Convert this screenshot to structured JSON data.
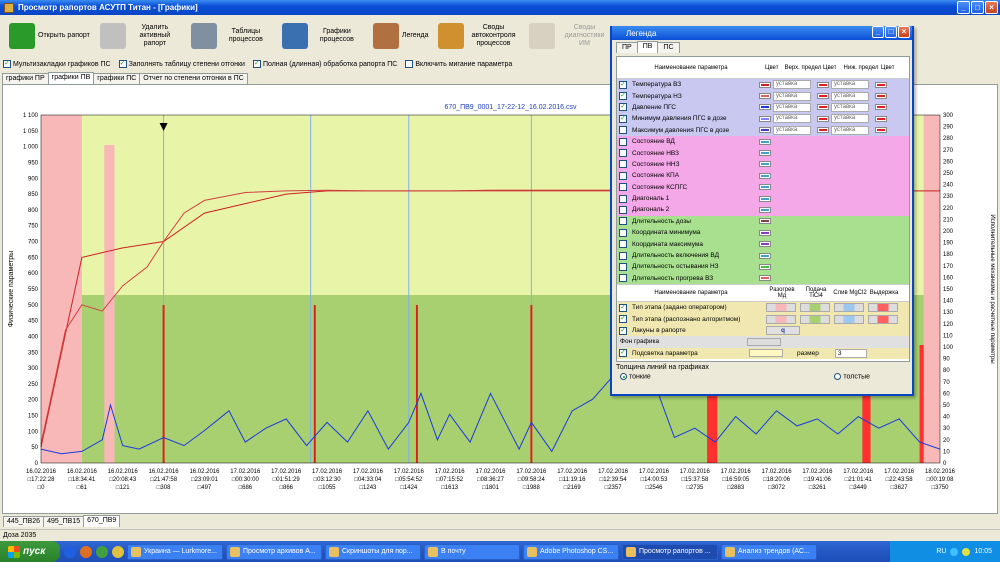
{
  "window": {
    "title": "Просмотр рапортов АСУТП Титан - [Графики]"
  },
  "toolbar": {
    "items": [
      {
        "label": "Открыть рапорт",
        "icon": "open-report-icon",
        "color": "#2a9a2a"
      },
      {
        "label": "Удалить активный рапорт",
        "icon": "delete-report-icon",
        "color": "#c0c0c0"
      },
      {
        "label": "Таблицы процессов",
        "icon": "table-icon",
        "color": "#8090a0"
      },
      {
        "label": "Графики процессов",
        "icon": "chart-icon",
        "color": "#3a70b0"
      },
      {
        "label": "Легенда",
        "icon": "legend-icon",
        "color": "#b07040"
      },
      {
        "label": "Своды автоконтроля процессов",
        "icon": "gears-icon",
        "color": "#d09030"
      },
      {
        "label": "Своды диагностики ИМ",
        "icon": "gears-disabled-icon",
        "color": "#d8d0c0",
        "disabled": true
      }
    ]
  },
  "options": [
    {
      "label": "Мультизакладки графиков ПС",
      "checked": true
    },
    {
      "label": "Заполнять таблицу степени отгонки",
      "checked": true
    },
    {
      "label": "Полная (длинная) обработка рапорта ПС",
      "checked": true
    },
    {
      "label": "Включить мигание параметра",
      "checked": false
    }
  ],
  "view_tabs": [
    {
      "label": "графики ПР",
      "active": false
    },
    {
      "label": "графики ПВ",
      "active": true
    },
    {
      "label": "графики ПС",
      "active": false
    },
    {
      "label": "Отчет по степени отгонки в ПС",
      "active": false
    }
  ],
  "chart": {
    "file_title": "670_ПВ9_0001_17-22-12_16.02.2016.csv",
    "left_axis_label": "Физические параметры",
    "right_axis_label": "Исполнительные механизмы и расчетные параметры",
    "bg_colors": {
      "light": "#e8f5a8",
      "green": "#a8d070",
      "pink": "#f8b8b8",
      "red": "#ff3030",
      "blue": "#1a3ae0"
    }
  },
  "chart_data": {
    "type": "line",
    "title": "670_ПВ9_0001_17-22-12_16.02.2016.csv",
    "ylim_left": [
      0,
      1100
    ],
    "yticks_left": [
      "0",
      "50",
      "100",
      "150",
      "200",
      "250",
      "300",
      "350",
      "400",
      "450",
      "500",
      "550",
      "600",
      "650",
      "700",
      "750",
      "800",
      "850",
      "900",
      "950",
      "1 000",
      "1 050",
      "1 100"
    ],
    "ylim_right": [
      0,
      300
    ],
    "yticks_right": [
      "0",
      "10",
      "20",
      "30",
      "40",
      "50",
      "60",
      "70",
      "80",
      "90",
      "100",
      "110",
      "120",
      "130",
      "140",
      "150",
      "160",
      "170",
      "180",
      "190",
      "200",
      "210",
      "220",
      "230",
      "240",
      "250",
      "260",
      "270",
      "280",
      "290",
      "300"
    ],
    "x_ticks": [
      {
        "date": "16.02.2016",
        "time": "□17:22:28",
        "idx": "□0"
      },
      {
        "date": "16.02.2016",
        "time": "□18:34:41",
        "idx": "□61"
      },
      {
        "date": "16.02.2016",
        "time": "□20:08:43",
        "idx": "□121"
      },
      {
        "date": "16.02.2016",
        "time": "□21:47:58",
        "idx": "□308"
      },
      {
        "date": "16.02.2016",
        "time": "□23:09:01",
        "idx": "□497"
      },
      {
        "date": "17.02.2016",
        "time": "□00:30:00",
        "idx": "□686"
      },
      {
        "date": "17.02.2016",
        "time": "□01:51:29",
        "idx": "□866"
      },
      {
        "date": "17.02.2016",
        "time": "□03:12:30",
        "idx": "□1055"
      },
      {
        "date": "17.02.2016",
        "time": "□04:33:04",
        "idx": "□1243"
      },
      {
        "date": "17.02.2016",
        "time": "□05:54:52",
        "idx": "□1424"
      },
      {
        "date": "17.02.2016",
        "time": "□07:15:52",
        "idx": "□1613"
      },
      {
        "date": "17.02.2016",
        "time": "□08:36:27",
        "idx": "□1801"
      },
      {
        "date": "17.02.2016",
        "time": "□09:58:24",
        "idx": "□1988"
      },
      {
        "date": "17.02.2016",
        "time": "□11:19:16",
        "idx": "□2169"
      },
      {
        "date": "17.02.2016",
        "time": "□12:39:54",
        "idx": "□2357"
      },
      {
        "date": "17.02.2016",
        "time": "□14:00:53",
        "idx": "□2546"
      },
      {
        "date": "17.02.2016",
        "time": "□15:37:58",
        "idx": "□2735"
      },
      {
        "date": "17.02.2016",
        "time": "□16:59:05",
        "idx": "□2883"
      },
      {
        "date": "17.02.2016",
        "time": "□18:20:06",
        "idx": "□3072"
      },
      {
        "date": "17.02.2016",
        "time": "□19:41:06",
        "idx": "□3261"
      },
      {
        "date": "17.02.2016",
        "time": "□21:01:41",
        "idx": "□3449"
      },
      {
        "date": "17.02.2016",
        "time": "□22:43:58",
        "idx": "□3627"
      },
      {
        "date": "18.02.2016",
        "time": "□00:19:08",
        "idx": "□3750"
      }
    ],
    "series": [
      {
        "name": "Температура ВЗ",
        "color": "#cc2020",
        "axis": "left",
        "points": [
          [
            0,
            50
          ],
          [
            1,
            650
          ],
          [
            2,
            680
          ],
          [
            3,
            700
          ],
          [
            4,
            790
          ],
          [
            5,
            820
          ],
          [
            6,
            850
          ],
          [
            7,
            860
          ],
          [
            8,
            860
          ],
          [
            9,
            860
          ],
          [
            10,
            860
          ],
          [
            11,
            862
          ],
          [
            12,
            862
          ],
          [
            13,
            862
          ],
          [
            14,
            862
          ],
          [
            15,
            862
          ],
          [
            16,
            862
          ],
          [
            17,
            862
          ],
          [
            18,
            860
          ],
          [
            19,
            860
          ],
          [
            20,
            860
          ],
          [
            21,
            860
          ],
          [
            22,
            860
          ]
        ]
      },
      {
        "name": "Температура НЗ",
        "color": "#d04040",
        "axis": "left",
        "points": [
          [
            0,
            60
          ],
          [
            0.6,
            420
          ],
          [
            1,
            500
          ],
          [
            1.5,
            480
          ],
          [
            2,
            560
          ],
          [
            2.6,
            620
          ],
          [
            3,
            700
          ],
          [
            3.5,
            790
          ],
          [
            4,
            830
          ],
          [
            5,
            855
          ],
          [
            6,
            860
          ],
          [
            7,
            862
          ],
          [
            8,
            860
          ],
          [
            9,
            860
          ],
          [
            10,
            860
          ],
          [
            11,
            860
          ],
          [
            12,
            860
          ],
          [
            13,
            860
          ],
          [
            14,
            860
          ],
          [
            15,
            860
          ],
          [
            16,
            860
          ],
          [
            17,
            860
          ],
          [
            18,
            860
          ],
          [
            19,
            860
          ],
          [
            20,
            860
          ],
          [
            21,
            860
          ],
          [
            22,
            860
          ]
        ]
      },
      {
        "name": "Давление ПГС",
        "color": "#1a3ae0",
        "axis": "right",
        "points": [
          [
            0,
            12
          ],
          [
            0.5,
            8
          ],
          [
            1,
            10
          ],
          [
            1.5,
            20
          ],
          [
            1.7,
            50
          ],
          [
            2,
            15
          ],
          [
            2.4,
            12
          ],
          [
            3,
            22
          ],
          [
            3.5,
            15
          ],
          [
            4,
            28
          ],
          [
            4.6,
            45
          ],
          [
            5,
            18
          ],
          [
            5.5,
            30
          ],
          [
            6,
            38
          ],
          [
            6.5,
            15
          ],
          [
            7,
            35
          ],
          [
            7.5,
            18
          ],
          [
            8,
            45
          ],
          [
            8.5,
            12
          ],
          [
            9,
            35
          ],
          [
            9.3,
            60
          ],
          [
            9.7,
            20
          ],
          [
            10,
            42
          ],
          [
            10.5,
            18
          ],
          [
            11,
            60
          ],
          [
            11.7,
            12
          ],
          [
            12,
            35
          ],
          [
            12.5,
            10
          ],
          [
            13,
            45
          ],
          [
            13.5,
            55
          ],
          [
            14,
            75
          ],
          [
            14.5,
            85
          ],
          [
            15,
            70
          ],
          [
            15.5,
            22
          ],
          [
            16,
            30
          ],
          [
            16.5,
            18
          ],
          [
            17,
            40
          ],
          [
            17.5,
            25
          ],
          [
            18,
            45
          ],
          [
            18.5,
            32
          ],
          [
            19,
            38
          ],
          [
            19.5,
            25
          ],
          [
            20,
            40
          ],
          [
            20.5,
            30
          ],
          [
            21,
            38
          ],
          [
            21.5,
            18
          ],
          [
            22,
            12
          ]
        ]
      }
    ]
  },
  "bottom_tabs": [
    {
      "label": "445_ПВ26",
      "active": false
    },
    {
      "label": "495_ПВ15",
      "active": false
    },
    {
      "label": "670_ПВ9",
      "active": true
    }
  ],
  "status": {
    "text": "Доза 2035"
  },
  "taskbar": {
    "start": "пуск",
    "tasks": [
      {
        "label": "Украина — Lurkmore...",
        "active": false
      },
      {
        "label": "Просмотр архивов А...",
        "active": false
      },
      {
        "label": "Скриншоты для пор...",
        "active": false
      },
      {
        "label": "В почту",
        "active": false
      },
      {
        "label": "Adobe Photoshop CS...",
        "active": false
      },
      {
        "label": "Просмотр рапортов ...",
        "active": true
      },
      {
        "label": "Анализ трендов (АС...",
        "active": false
      }
    ],
    "lang": "RU",
    "clock": "10:05"
  },
  "legend": {
    "title": "Легенда",
    "tabs": [
      {
        "label": "ПР",
        "active": false
      },
      {
        "label": "ПВ",
        "active": true
      },
      {
        "label": "ПС",
        "active": false
      }
    ],
    "headers": {
      "name": "Наименование параметра",
      "color": "Цвет",
      "upper": "Верх. предел",
      "lower": "Ниж. предел"
    },
    "rows": [
      {
        "name": "Температура ВЗ",
        "checked": true,
        "color": "#d02020",
        "limit_up": "уставка",
        "limit_dn": "уставка",
        "bg": "#c8c8f0"
      },
      {
        "name": "Температура НЗ",
        "checked": true,
        "color": "#e06060",
        "limit_up": "уставка",
        "limit_dn": "уставка",
        "bg": "#c8c8f0"
      },
      {
        "name": "Давление ПГС",
        "checked": true,
        "color": "#1a3ae0",
        "limit_up": "уставка",
        "limit_dn": "уставка",
        "bg": "#c8c8f0"
      },
      {
        "name": "Минимум давления ПГС в дозе",
        "checked": true,
        "color": "#8080ff",
        "limit_up": "уставка",
        "limit_dn": "уставка",
        "bg": "#c8c8f0"
      },
      {
        "name": "Максимум давления ПГС в дозе",
        "checked": false,
        "color": "#4040c0",
        "limit_up": "уставка",
        "limit_dn": "уставка",
        "bg": "#c8c8f0"
      },
      {
        "name": "Состояние ВД",
        "checked": false,
        "color": "#40a0d0",
        "bg": "#f4a8e8"
      },
      {
        "name": "Состояние НВЗ",
        "checked": false,
        "color": "#40a0d0",
        "bg": "#f4a8e8"
      },
      {
        "name": "Состояние ННЗ",
        "checked": false,
        "color": "#40a0d0",
        "bg": "#f4a8e8"
      },
      {
        "name": "Состояние КПА",
        "checked": false,
        "color": "#40a0d0",
        "bg": "#f4a8e8"
      },
      {
        "name": "Состояние КСПГС",
        "checked": false,
        "color": "#40a0d0",
        "bg": "#f4a8e8"
      },
      {
        "name": "Диагональ 1",
        "checked": false,
        "color": "#40a0d0",
        "bg": "#f4a8e8"
      },
      {
        "name": "Диагональ 2",
        "checked": false,
        "color": "#40a0d0",
        "bg": "#f4a8e8"
      },
      {
        "name": "Длительность дозы",
        "checked": false,
        "color": "#804040",
        "bg": "#a8e090"
      },
      {
        "name": "Координата минимума",
        "checked": false,
        "color": "#8040c0",
        "bg": "#a8e090"
      },
      {
        "name": "Координата максимума",
        "checked": false,
        "color": "#8040c0",
        "bg": "#a8e090"
      },
      {
        "name": "Длительность включения ВД",
        "checked": false,
        "color": "#40a0d0",
        "bg": "#a8e090"
      },
      {
        "name": "Длительность остывания НЗ",
        "checked": false,
        "color": "#40c040",
        "bg": "#a8e090"
      },
      {
        "name": "Длительность прогрева ВЗ",
        "checked": false,
        "color": "#e06060",
        "bg": "#a8e090"
      }
    ],
    "stage_headers": [
      "Наименование параметра",
      "Разогрев Мд",
      "Подача TiCl4",
      "Слив MgCl2",
      "Выдержка"
    ],
    "stage_rows": [
      {
        "name": "Тип этапа (задано оператором)",
        "checked": true
      },
      {
        "name": "Тип этапа (распознано алгоритмом)",
        "checked": true
      },
      {
        "name": "Лакуны в рапорте",
        "checked": true,
        "glyph": "q"
      }
    ],
    "bg_label": "Фон графика",
    "highlight": {
      "name": "Подсветка параметра",
      "checked": true,
      "size_label": "размер",
      "size_value": "3"
    },
    "line_width": {
      "label": "Толщина линий на графиках",
      "thin": "тонкие",
      "thick": "толстые",
      "selected": "thin"
    },
    "stage_colors": [
      "#f8b8b8",
      "#a8d070",
      "#9cc8f0",
      "#ff6060"
    ]
  }
}
